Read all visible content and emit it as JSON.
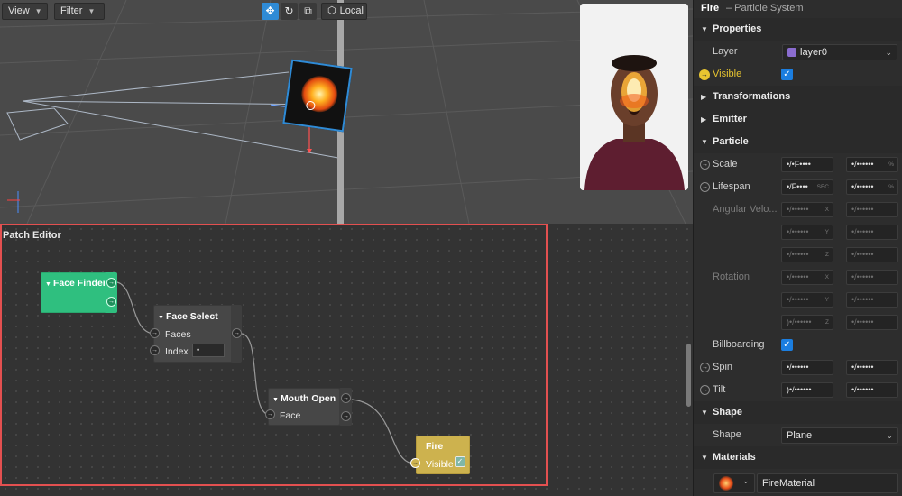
{
  "viewport": {
    "view_label": "View",
    "filter_label": "Filter",
    "transform_icons": [
      "move-icon",
      "rotate-icon",
      "scale-icon"
    ],
    "space_label": "Local"
  },
  "patch_editor": {
    "title": "Patch Editor",
    "nodes": {
      "face_finder": {
        "title": "Face Finder",
        "color": "#2fbf7f"
      },
      "face_select": {
        "title": "Face Select",
        "port_faces": "Faces",
        "port_index": "Index",
        "index_value": "•"
      },
      "mouth_open": {
        "title": "Mouth Open",
        "port_face": "Face"
      },
      "fire": {
        "title": "Fire",
        "port_visible": "Visible",
        "color": "#cdb24e"
      }
    }
  },
  "inspector": {
    "object_name": "Fire",
    "object_type": "– Particle System",
    "properties_title": "Properties",
    "layer_label": "Layer",
    "layer_value": "layer0",
    "visible_label": "Visible",
    "transformations_title": "Transformations",
    "emitter_title": "Emitter",
    "particle_title": "Particle",
    "scale_label": "Scale",
    "scale_value1": "•/•F••••",
    "scale_value2": "•/••••••",
    "scale_unit2": "%",
    "lifespan_label": "Lifespan",
    "lifespan_value1": "•/F••••",
    "lifespan_unit1": "SEC",
    "lifespan_value2": "•/••••••",
    "lifespan_unit2": "%",
    "angular_label": "Angular Velo...",
    "angular_values": [
      "•/••••••",
      "•/••••••",
      "•/••••••",
      "•/••••••",
      "•/••••••",
      "•/••••••"
    ],
    "axis_x": "X",
    "axis_y": "Y",
    "axis_z": "Z",
    "rotation_label": "Rotation",
    "rotation_values": [
      "•/••••••",
      "•/••••••",
      "•/••••••",
      "•/••••••",
      ")•/••••••",
      "•/••••••"
    ],
    "billboarding_label": "Billboarding",
    "spin_label": "Spin",
    "spin_value1": "•/••••••",
    "spin_value2": "•/••••••",
    "tilt_label": "Tilt",
    "tilt_value1": ")•/••••••",
    "tilt_value2": "•/••••••",
    "shape_title": "Shape",
    "shape_label": "Shape",
    "shape_value": "Plane",
    "materials_title": "Materials",
    "material_value": "FireMaterial"
  },
  "colors": {
    "accent_blue": "#2f8bd6",
    "highlight_red": "#e35050",
    "layer_swatch": "#8a6ccf"
  }
}
